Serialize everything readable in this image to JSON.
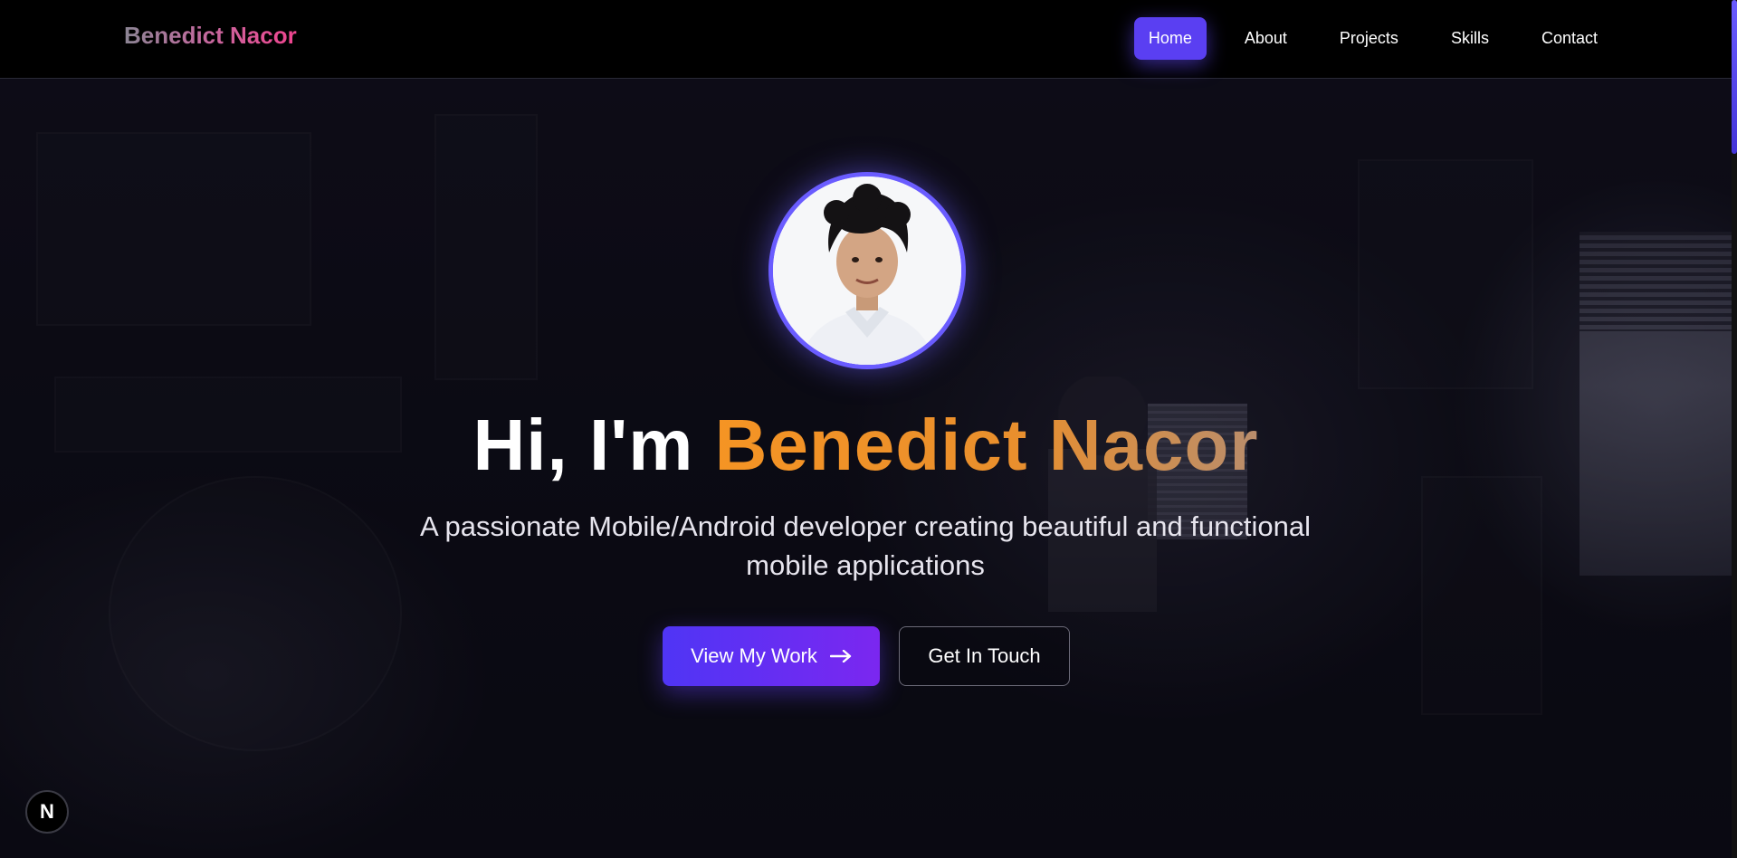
{
  "brand": {
    "name": "Benedict Nacor"
  },
  "nav": {
    "items": [
      {
        "label": "Home",
        "active": true
      },
      {
        "label": "About",
        "active": false
      },
      {
        "label": "Projects",
        "active": false
      },
      {
        "label": "Skills",
        "active": false
      },
      {
        "label": "Contact",
        "active": false
      }
    ]
  },
  "hero": {
    "greeting": "Hi, I'm",
    "name": "Benedict Nacor",
    "subtitle": "A passionate Mobile/Android developer creating beautiful and functional mobile applications",
    "primary_button": {
      "label": "View My Work",
      "icon": "arrow-right-icon"
    },
    "secondary_button": {
      "label": "Get In Touch"
    }
  },
  "badge": {
    "label": "N",
    "icon": "nextjs-icon"
  },
  "colors": {
    "accent": "#5a3ff2",
    "name_gradient_start": "#f59424",
    "name_gradient_end": "#b98d6c",
    "brand_gradient_end": "#f0448f",
    "background": "#0b0a12"
  }
}
